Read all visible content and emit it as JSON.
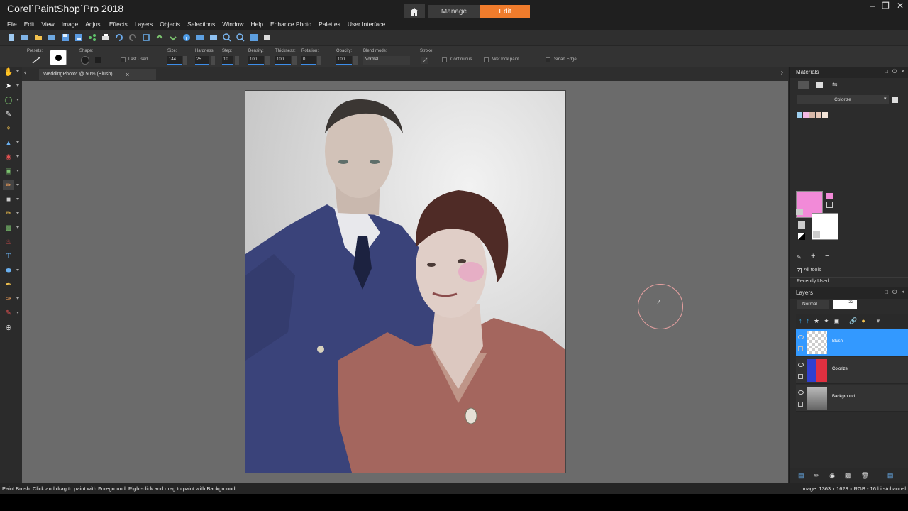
{
  "app": {
    "title": "Corel´PaintShop´Pro 2018",
    "workspace_tabs": [
      {
        "label": "Manage",
        "active": false
      },
      {
        "label": "Edit",
        "active": true
      }
    ],
    "accent_color": "#f07c2c"
  },
  "menu": [
    "File",
    "Edit",
    "View",
    "Image",
    "Adjust",
    "Effects",
    "Layers",
    "Objects",
    "Selections",
    "Window",
    "Help",
    "Enhance Photo",
    "Palettes",
    "User Interface"
  ],
  "tool_options": {
    "presets_label": "Presets:",
    "shape_label": "Shape:",
    "last_used_label": "Last Used",
    "size_label": "Size:",
    "size_value": "144",
    "hardness_label": "Hardness:",
    "hardness_value": "25",
    "step_label": "Step:",
    "step_value": "10",
    "density_label": "Density:",
    "density_value": "100",
    "thickness_label": "Thickness:",
    "thickness_value": "100",
    "rotation_label": "Rotation:",
    "rotation_value": "0",
    "opacity_label": "Opacity:",
    "opacity_value": "100",
    "blend_label": "Blend mode:",
    "blend_value": "Normal",
    "stroke_label": "Stroke:",
    "continuous_label": "Continuous",
    "wet_look_label": "Wet look paint",
    "smart_edge_label": "Smart Edge"
  },
  "document": {
    "tab_label": "WeddingPhoto* @  50% (Blush)"
  },
  "materials": {
    "title": "Materials",
    "mode_value": "Colorize",
    "foreground_color": "#f28ad8",
    "background_color": "#ffffff",
    "swatches": [
      "#9fd0f0",
      "#f4b8e4",
      "#d8b8a8",
      "#e8c8b8",
      "#f4e4d8"
    ],
    "all_tools_label": "All tools",
    "recently_used_label": "Recently Used"
  },
  "layers": {
    "title": "Layers",
    "blend_value": "Normal",
    "opacity_value": "22",
    "items": [
      {
        "name": "Blush",
        "selected": true
      },
      {
        "name": "Colorize",
        "selected": false
      },
      {
        "name": "Background",
        "selected": false
      }
    ]
  },
  "status": {
    "left": "Paint Brush: Click and drag to paint with Foreground. Right-click and drag to paint with Background.",
    "right": "Image:  1363 x 1623 x RGB - 16 bits/channel"
  }
}
